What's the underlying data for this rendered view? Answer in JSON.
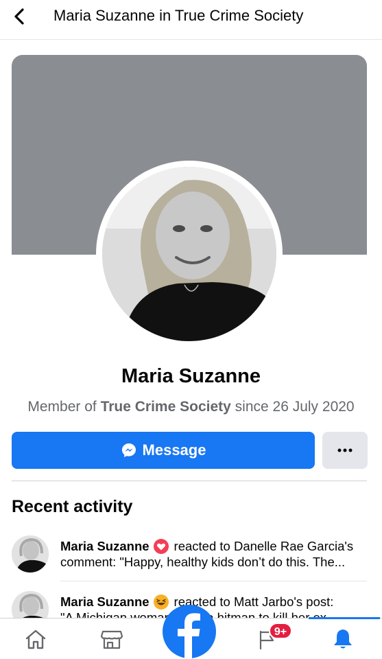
{
  "header": {
    "title": "Maria Suzanne in True Crime Society",
    "back_icon": "chevron-left-icon"
  },
  "profile": {
    "name": "Maria Suzanne",
    "member_prefix": "Member of ",
    "group_name": "True Crime Society",
    "member_suffix": " since 26 July 2020",
    "cover_color": "#8a8d91"
  },
  "actions": {
    "message_label": "Message",
    "message_icon": "messenger-icon",
    "more_icon": "more-dots-icon"
  },
  "recent_activity": {
    "title": "Recent activity",
    "items": [
      {
        "actor": "Maria Suzanne",
        "reaction": "love-reaction-icon",
        "line1_rest": "reacted to Danelle Rae Garcia's",
        "line2": "comment: \"Happy, healthy kids don’t do this. The..."
      },
      {
        "actor": "Maria Suzanne",
        "reaction": "haha-reaction-icon",
        "line1_rest": "reacted to Matt Jarbo's post:",
        "line2": "\"A Michigan woman hired a hitman to kill her ex"
      }
    ]
  },
  "bottom_nav": {
    "items": [
      "home-icon",
      "marketplace-icon",
      "facebook-logo-icon",
      "flag-icon",
      "notifications-bell-icon"
    ],
    "badge": "9+",
    "accent": "#1877f2",
    "badge_color": "#e41e3f"
  }
}
